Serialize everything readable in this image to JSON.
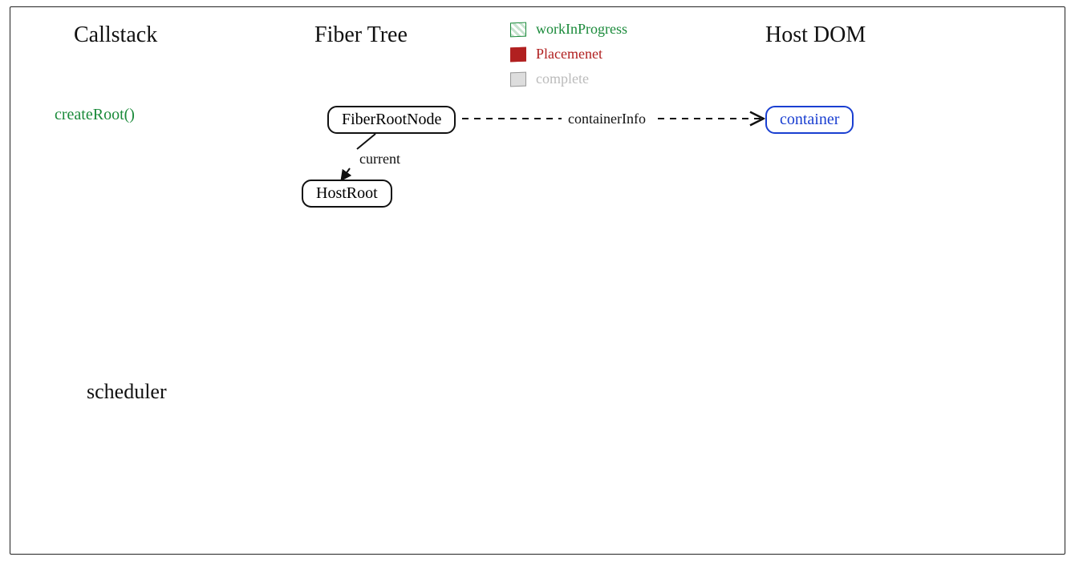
{
  "headings": {
    "callstack": "Callstack",
    "fiber_tree": "Fiber Tree",
    "host_dom": "Host DOM",
    "scheduler": "scheduler"
  },
  "callstack": {
    "items": [
      "createRoot()"
    ]
  },
  "legend": {
    "workInProgress": "workInProgress",
    "placement": "Placemenet",
    "complete": "complete"
  },
  "nodes": {
    "fiber_root": "FiberRootNode",
    "host_root": "HostRoot",
    "container": "container"
  },
  "edges": {
    "current": "current",
    "containerInfo": "containerInfo"
  }
}
